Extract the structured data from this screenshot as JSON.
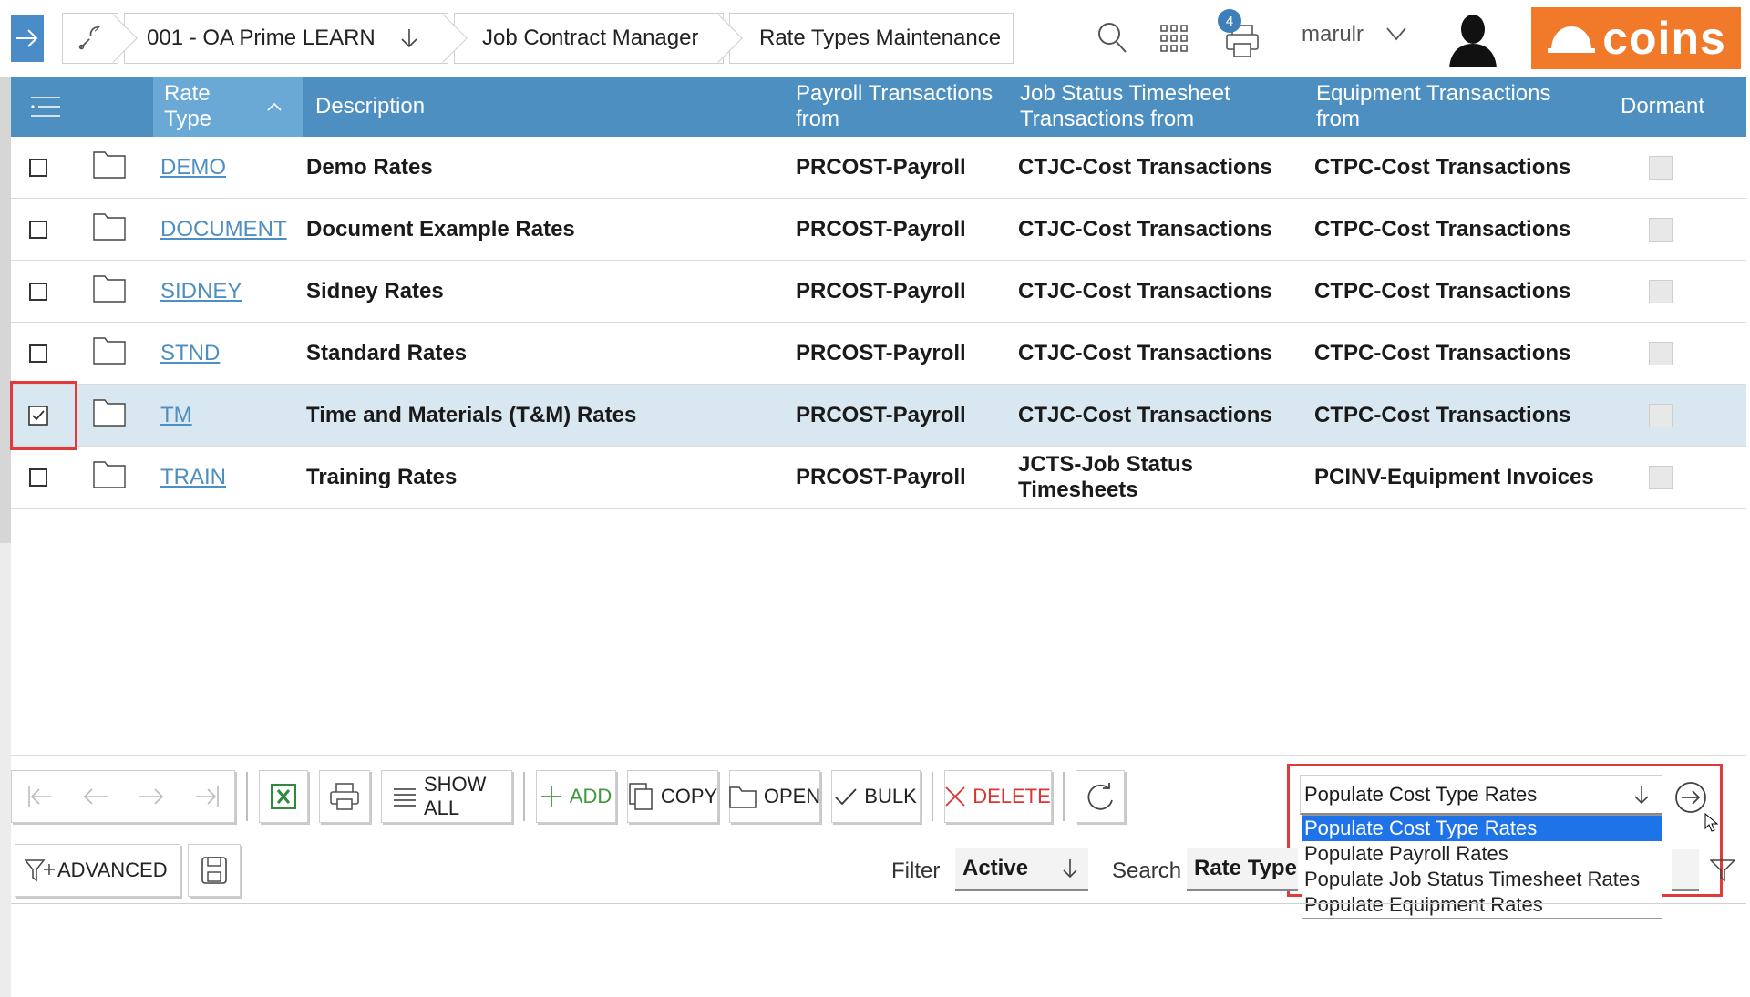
{
  "breadcrumb": {
    "company": "001 - OA Prime LEARN",
    "module": "Job Contract Manager",
    "page": "Rate Types Maintenance"
  },
  "header": {
    "print_badge": "4",
    "username": "marulr",
    "brand": "coins"
  },
  "grid": {
    "columns": {
      "rate_type": "Rate Type",
      "description": "Description",
      "payroll": "Payroll Transactions from",
      "job_status": "Job Status Timesheet Transactions from",
      "equipment": "Equipment Transactions from",
      "dormant": "Dormant"
    },
    "rows": [
      {
        "code": "DEMO",
        "description": "Demo Rates",
        "payroll": "PRCOST-Payroll",
        "job_status": "CTJC-Cost Transactions",
        "equipment": "CTPC-Cost Transactions",
        "checked": false
      },
      {
        "code": "DOCUMENT",
        "description": "Document Example Rates",
        "payroll": "PRCOST-Payroll",
        "job_status": "CTJC-Cost Transactions",
        "equipment": "CTPC-Cost Transactions",
        "checked": false
      },
      {
        "code": "SIDNEY",
        "description": "Sidney Rates",
        "payroll": "PRCOST-Payroll",
        "job_status": "CTJC-Cost Transactions",
        "equipment": "CTPC-Cost Transactions",
        "checked": false
      },
      {
        "code": "STND",
        "description": "Standard Rates",
        "payroll": "PRCOST-Payroll",
        "job_status": "CTJC-Cost Transactions",
        "equipment": "CTPC-Cost Transactions",
        "checked": false
      },
      {
        "code": "TM",
        "description": "Time and Materials (T&M) Rates",
        "payroll": "PRCOST-Payroll",
        "job_status": "CTJC-Cost Transactions",
        "equipment": "CTPC-Cost Transactions",
        "checked": true
      },
      {
        "code": "TRAIN",
        "description": "Training Rates",
        "payroll": "PRCOST-Payroll",
        "job_status": "JCTS-Job Status Timesheets",
        "equipment": "PCINV-Equipment Invoices",
        "checked": false
      }
    ]
  },
  "toolbar": {
    "show_all": "SHOW ALL",
    "add": "ADD",
    "copy": "COPY",
    "open": "OPEN",
    "bulk": "BULK",
    "delete": "DELETE",
    "action_selected": "Populate Cost Type Rates",
    "action_options": [
      "Populate Cost Type Rates",
      "Populate Payroll Rates",
      "Populate Job Status Timesheet Rates",
      "Populate Equipment Rates"
    ]
  },
  "filterbar": {
    "advanced": "ADVANCED",
    "filter_label": "Filter",
    "filter_value": "Active",
    "search_label": "Search",
    "search_field": "Rate Type"
  },
  "colors": {
    "header_bg": "#4e8fc1",
    "sorted_header_bg": "#6aa9d6",
    "brand_orange": "#f07a2a",
    "highlight_red": "#e03a3a",
    "selected_row": "#d9e7f1",
    "link": "#4e8fc1"
  }
}
